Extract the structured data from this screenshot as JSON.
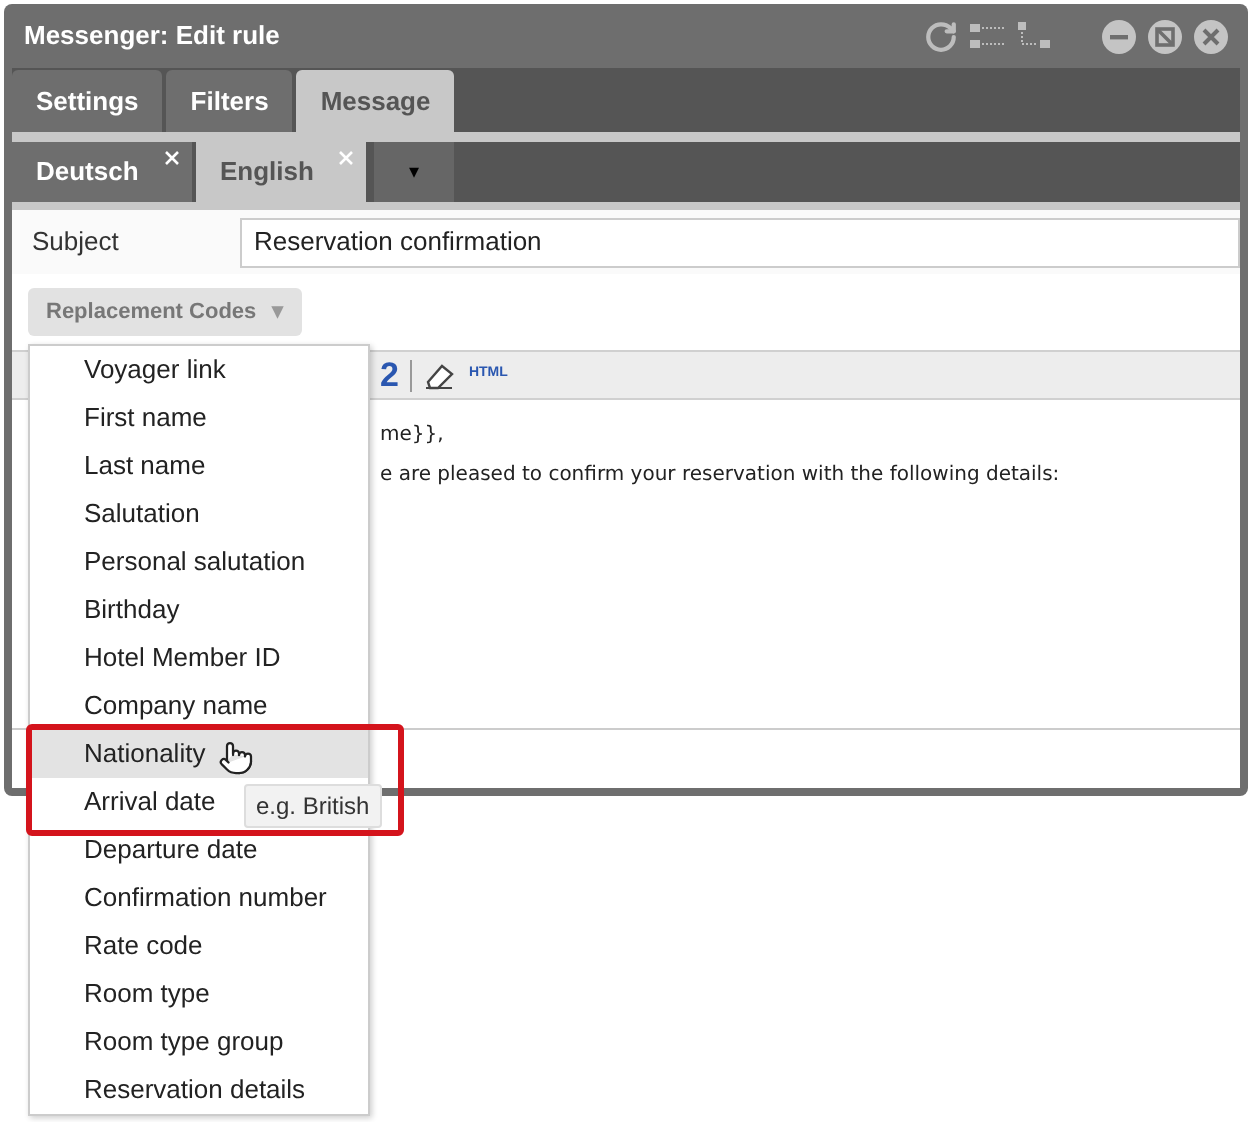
{
  "window": {
    "title": "Messenger: Edit rule"
  },
  "tabs": [
    {
      "label": "Settings",
      "selected": false
    },
    {
      "label": "Filters",
      "selected": false
    },
    {
      "label": "Message",
      "selected": true
    }
  ],
  "language_tabs": [
    {
      "label": "Deutsch",
      "selected": false,
      "closable": true
    },
    {
      "label": "English",
      "selected": true,
      "closable": true
    }
  ],
  "language_menu": {
    "symbol": "▾"
  },
  "subject": {
    "label": "Subject",
    "value": "Reservation confirmation"
  },
  "replacement_codes": {
    "label": "Replacement Codes",
    "caret": "▾",
    "expanded": true,
    "items": [
      {
        "label": "Voyager link",
        "hovered": false
      },
      {
        "label": "First name",
        "hovered": false
      },
      {
        "label": "Last name",
        "hovered": false
      },
      {
        "label": "Salutation",
        "hovered": false
      },
      {
        "label": "Personal salutation",
        "hovered": false
      },
      {
        "label": "Birthday",
        "hovered": false
      },
      {
        "label": "Hotel Member ID",
        "hovered": false
      },
      {
        "label": "Company name",
        "hovered": false
      },
      {
        "label": "Nationality",
        "hovered": true,
        "tooltip": "e.g. British"
      },
      {
        "label": "Arrival date",
        "hovered": false
      },
      {
        "label": "Departure date",
        "hovered": false
      },
      {
        "label": "Confirmation number",
        "hovered": false
      },
      {
        "label": "Rate code",
        "hovered": false
      },
      {
        "label": "Room type",
        "hovered": false
      },
      {
        "label": "Room type group",
        "hovered": false
      },
      {
        "label": "Reservation details",
        "hovered": false
      }
    ]
  },
  "toolbar": {
    "partial_icon": "2",
    "html_label": "HTML"
  },
  "editor": {
    "lines": [
      "me}},",
      "e are pleased to confirm your reservation with the following details:"
    ]
  }
}
